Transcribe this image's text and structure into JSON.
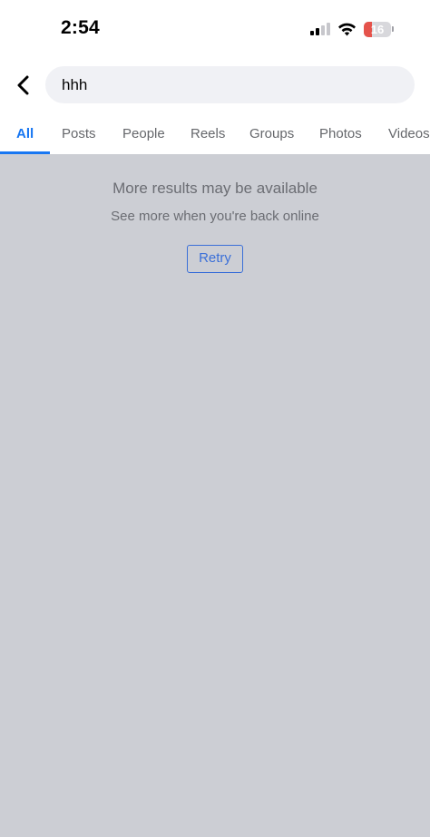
{
  "status_bar": {
    "time": "2:54",
    "battery_level": "16",
    "battery_fraction": 0.16,
    "icons": [
      "cellular-signal-icon",
      "wifi-icon",
      "battery-icon"
    ]
  },
  "header": {
    "back_icon": "chevron-left-icon",
    "search_value": "hhh"
  },
  "tabs": [
    {
      "label": "All",
      "active": true
    },
    {
      "label": "Posts",
      "active": false
    },
    {
      "label": "People",
      "active": false
    },
    {
      "label": "Reels",
      "active": false
    },
    {
      "label": "Groups",
      "active": false
    },
    {
      "label": "Photos",
      "active": false
    },
    {
      "label": "Videos",
      "active": false
    }
  ],
  "offline_notice": {
    "title": "More results may be available",
    "subtitle": "See more when you're back online",
    "retry_label": "Retry"
  },
  "colors": {
    "accent": "#1877f2",
    "content_background": "#ccced4",
    "battery_low": "#e5534b"
  }
}
